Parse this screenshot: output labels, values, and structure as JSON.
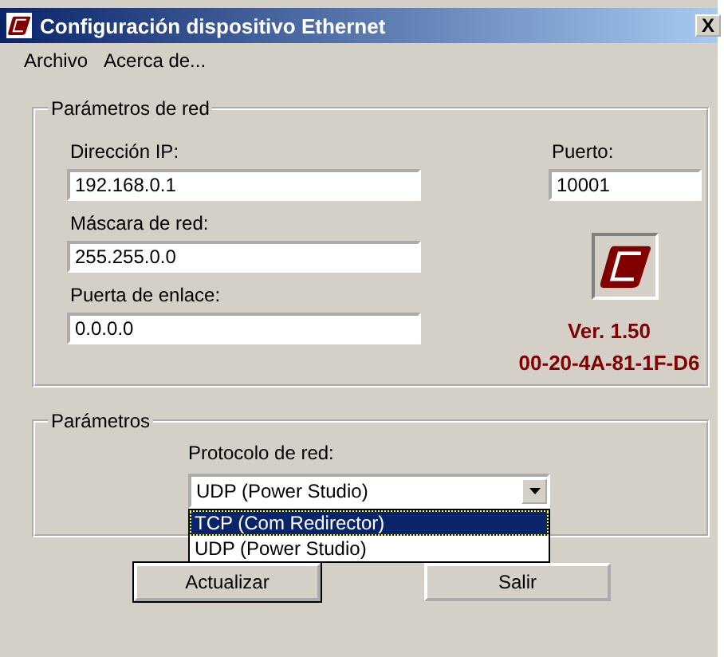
{
  "window": {
    "title": "Configuración dispositivo Ethernet",
    "close": "X"
  },
  "menu": [
    {
      "label": "Archivo"
    },
    {
      "label": "Acerca de..."
    }
  ],
  "network_group": {
    "title": "Parámetros de red",
    "fields": [
      {
        "label": "Dirección IP:",
        "value": "192.168.0.1"
      },
      {
        "label": "Máscara de red:",
        "value": "255.255.0.0"
      },
      {
        "label": "Puerta de enlace:",
        "value": "0.0.0.0"
      }
    ],
    "port": {
      "label": "Puerto:",
      "value": "10001"
    },
    "version": "Ver. 1.50",
    "mac": "00-20-4A-81-1F-D6"
  },
  "params_group": {
    "title": "Parámetros",
    "protocol": {
      "label": "Protocolo de red:",
      "value": "UDP (Power Studio)",
      "expanded": true,
      "options": [
        {
          "label": "TCP (Com Redirector)",
          "highlighted": true
        },
        {
          "label": "UDP (Power Studio)",
          "highlighted": false
        }
      ]
    }
  },
  "buttons": [
    {
      "label": "Actualizar",
      "default": true
    },
    {
      "label": "Salir",
      "default": false
    }
  ]
}
